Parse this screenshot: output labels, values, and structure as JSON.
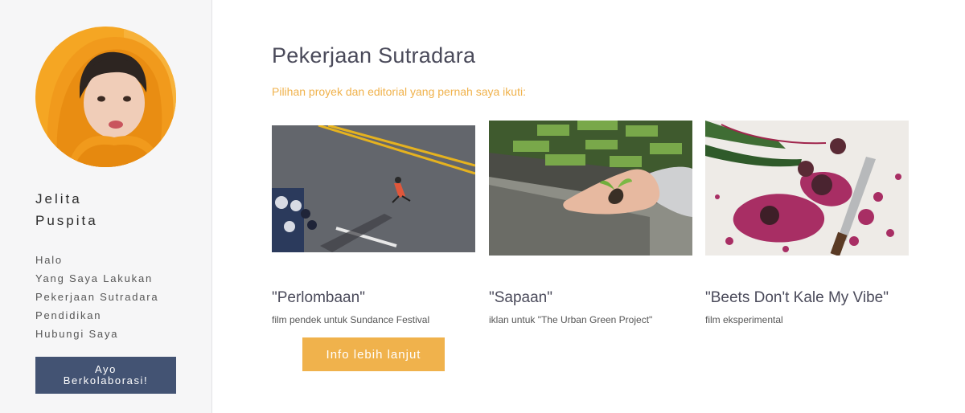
{
  "profile": {
    "first_name": "Jelita",
    "last_name": "Puspita"
  },
  "nav": {
    "items": [
      "Halo",
      "Yang Saya Lakukan",
      "Pekerjaan Sutradara",
      "Pendidikan",
      "Hubungi Saya"
    ]
  },
  "collab_button": {
    "line1": "Ayo",
    "line2": "Berkolaborasi!"
  },
  "main": {
    "title": "Pekerjaan Sutradara",
    "subtitle": "Pilihan proyek dan editorial yang pernah saya ikuti:"
  },
  "projects": [
    {
      "title": "\"Perlombaan\"",
      "desc": "film pendek untuk Sundance Festival"
    },
    {
      "title": "\"Sapaan\"",
      "desc": "iklan untuk \"The Urban Green Project\""
    },
    {
      "title": "\"Beets Don't Kale My Vibe\"",
      "desc": "film eksperimental"
    }
  ],
  "more_button": {
    "label": "Info lebih lanjut"
  },
  "colors": {
    "accent": "#f0b24c",
    "button_navy": "#435373",
    "sidebar_bg": "#f6f6f7"
  }
}
